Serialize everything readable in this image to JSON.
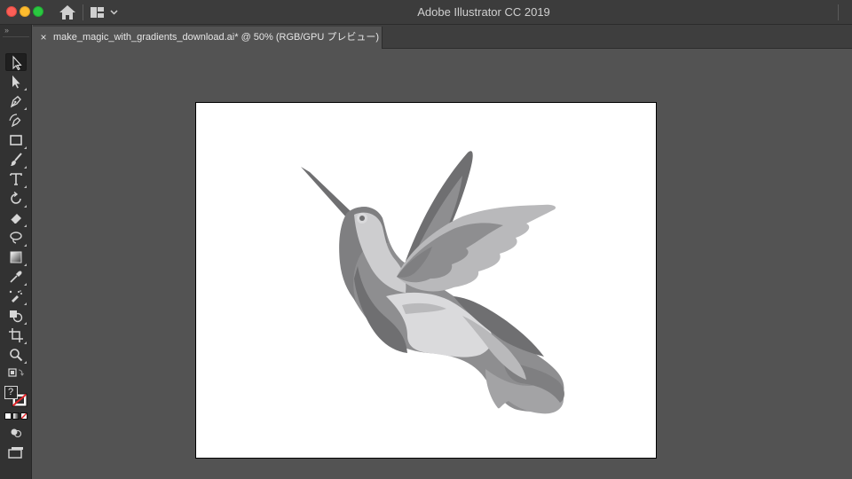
{
  "window": {
    "app_title": "Adobe Illustrator CC 2019"
  },
  "document_tab": {
    "close_glyph": "×",
    "title": "make_magic_with_gradients_download.ai* @ 50% (RGB/GPU プレビュー)"
  },
  "tool_panel": {
    "grip_glyph": "››",
    "tools": [
      {
        "name": "selection-tool",
        "icon": "black-arrow-icon",
        "active": true
      },
      {
        "name": "direct-selection-tool",
        "icon": "white-arrow-icon"
      },
      {
        "name": "pen-tool",
        "icon": "pen-nib-icon"
      },
      {
        "name": "curvature-tool",
        "icon": "curvature-pen-icon"
      },
      {
        "name": "rectangle-tool",
        "icon": "rectangle-icon"
      },
      {
        "name": "paintbrush-tool",
        "icon": "paintbrush-icon"
      },
      {
        "name": "type-tool",
        "icon": "type-t-icon",
        "label": "T"
      },
      {
        "name": "rotate-tool",
        "icon": "rotate-icon"
      },
      {
        "name": "eraser-tool",
        "icon": "eraser-icon"
      },
      {
        "name": "lasso-tool",
        "icon": "lasso-icon"
      },
      {
        "name": "gradient-tool",
        "icon": "gradient-swatch-icon"
      },
      {
        "name": "eyedropper-tool",
        "icon": "eyedropper-icon"
      },
      {
        "name": "symbol-sprayer-tool",
        "icon": "sprayer-icon"
      },
      {
        "name": "shape-builder-tool",
        "icon": "shape-builder-icon"
      },
      {
        "name": "artboard-tool",
        "icon": "artboard-crop-icon"
      },
      {
        "name": "zoom-tool",
        "icon": "magnifier-icon"
      }
    ],
    "fill_stroke_label": "?",
    "colors": {
      "panel_bg": "#323232",
      "icon": "#d6d6d6",
      "none_red": "#e0262b"
    }
  },
  "artwork": {
    "subject": "hummingbird",
    "palette": [
      "#6f6f71",
      "#7f7f81",
      "#8e8e90",
      "#a3a3a5",
      "#b9b9bb",
      "#cdcdcf",
      "#dadadc"
    ]
  }
}
